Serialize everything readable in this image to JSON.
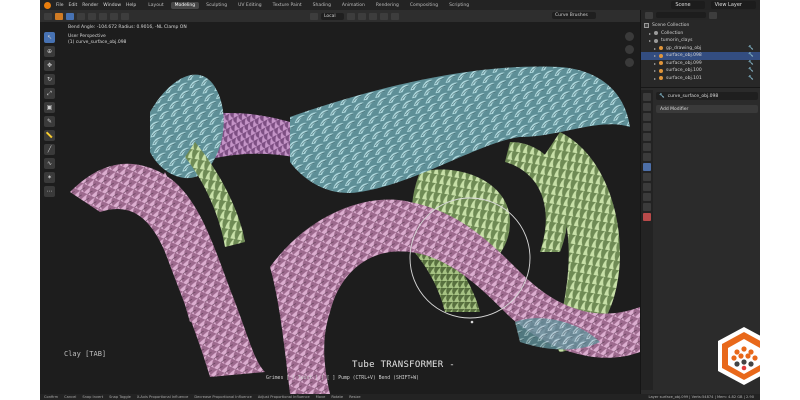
{
  "menubar": {
    "items": [
      "File",
      "Edit",
      "Render",
      "Window",
      "Help"
    ],
    "workspaces": [
      {
        "label": "Layout",
        "active": false
      },
      {
        "label": "Modeling",
        "active": true
      },
      {
        "label": "Sculpting",
        "active": false
      },
      {
        "label": "UV Editing",
        "active": false
      },
      {
        "label": "Texture Paint",
        "active": false
      },
      {
        "label": "Shading",
        "active": false
      },
      {
        "label": "Animation",
        "active": false
      },
      {
        "label": "Rendering",
        "active": false
      },
      {
        "label": "Compositing",
        "active": false
      },
      {
        "label": "Scripting",
        "active": false
      }
    ],
    "scene": "Scene",
    "view_layer": "View Layer"
  },
  "tool_header": {
    "orientation": "Local",
    "brush": "Curve Brushes"
  },
  "viewport": {
    "status_line": "Bend Angle: -104.672  Radius: 0.9016, -NL Clamp ON",
    "perspective": "User Perspective",
    "object_info": "(1) curve_surface_obj.098",
    "mode_text": "Clay [TAB]",
    "overlay_title": "Tube TRANSFORMER -",
    "overlay_hints": "Grimes   [ ] Twist  [  ]   [ ] Pump (CTRL+V)   Bend (SHIFT+W)"
  },
  "outliner": {
    "root": "Scene Collection",
    "items": [
      {
        "label": "Collection",
        "indent": 1,
        "color": "#9a9a9a",
        "selected": false
      },
      {
        "label": "tumorin_clays",
        "indent": 1,
        "color": "#9a9a9a",
        "selected": false
      },
      {
        "label": "gp_drawing_obj",
        "indent": 2,
        "color": "#e0953a",
        "selected": false
      },
      {
        "label": "surface_obj.098",
        "indent": 2,
        "color": "#e0953a",
        "selected": true
      },
      {
        "label": "surface_obj.099",
        "indent": 2,
        "color": "#e0953a",
        "selected": false
      },
      {
        "label": "surface_obj.100",
        "indent": 2,
        "color": "#e0953a",
        "selected": false
      },
      {
        "label": "surface_obj.101",
        "indent": 2,
        "color": "#e0953a",
        "selected": false
      }
    ]
  },
  "properties": {
    "object_name": "curve_surface_obj.098",
    "add_modifier": "Add Modifier"
  },
  "statusbar": {
    "hints": [
      "Confirm",
      "Cancel",
      "Snap Invert",
      "Snap Toggle",
      "X-Axis Proportional Influence",
      "Decrease Proportional Influence",
      "Adjust Proportional Influence",
      "Move",
      "Rotate",
      "Resize"
    ],
    "stats": "Layer surface_obj.099 | Verts:54874 | Mem: 4.82 GB | 2.90"
  },
  "colors": {
    "accent": "#4772b3",
    "pink_tube": "#c98fb6",
    "teal_mesh": "#8fc1c8",
    "green_mesh": "#a9c58f",
    "badge_orange": "#e8681a"
  }
}
